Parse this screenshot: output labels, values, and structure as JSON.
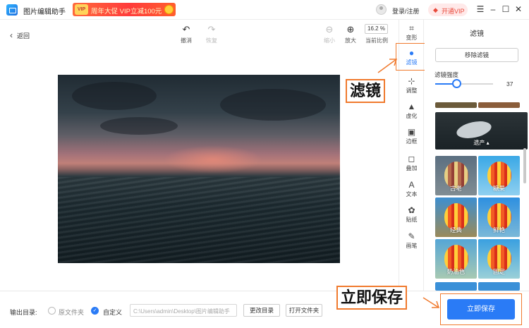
{
  "titlebar": {
    "app_title": "图片编辑助手",
    "promo_badge": "VIP",
    "promo_text": "周年大促 VIP立减100元",
    "login": "登录/注册",
    "vip_button": "开通VIP",
    "vip_icon": "diamond-icon",
    "window_controls": [
      "menu-icon",
      "minimize-icon",
      "maximize-icon",
      "close-icon"
    ]
  },
  "toolbar": {
    "back": "返回",
    "undo": "撤消",
    "redo": "恢复",
    "zoom_out": "缩小",
    "zoom_in": "放大",
    "zoom_value": "16.2 %",
    "zoom_label": "当前比例"
  },
  "tabs": [
    {
      "label": "变形",
      "icon": "crop-icon"
    },
    {
      "label": "滤镜",
      "icon": "filter-drop-icon",
      "active": true
    },
    {
      "label": "调整",
      "icon": "adjust-icon"
    },
    {
      "label": "虚化",
      "icon": "blur-drop-icon"
    },
    {
      "label": "边框",
      "icon": "frame-icon"
    },
    {
      "label": "叠加",
      "icon": "overlay-icon"
    },
    {
      "label": "文本",
      "icon": "text-icon"
    },
    {
      "label": "贴纸",
      "icon": "sticker-icon"
    },
    {
      "label": "画笔",
      "icon": "brush-icon"
    }
  ],
  "panel": {
    "title": "滤镜",
    "remove_button": "移除滤镜",
    "intensity_label": "滤镜强度",
    "intensity_value": "37",
    "intensity_fraction": 0.37,
    "filters": [
      {
        "name": "遗产"
      },
      {
        "name": "古老"
      },
      {
        "name": "糖果"
      },
      {
        "name": "经典"
      },
      {
        "name": "鲜艳"
      },
      {
        "name": "奶油色"
      },
      {
        "name": "固定"
      }
    ]
  },
  "bottom": {
    "output_label": "输出目录:",
    "option_source": "原文件夹",
    "option_custom": "自定义",
    "path_value": "C:\\Users\\admin\\Desktop\\图片编辑助手",
    "change_dir": "更改目录",
    "open_folder": "打开文件夹",
    "save_button": "立即保存"
  },
  "annotations": {
    "filter_callout": "滤镜",
    "save_callout": "立即保存"
  },
  "colors": {
    "accent": "#2a7bf6",
    "highlight": "#f07a2e",
    "promo": "#ff3b3b"
  }
}
